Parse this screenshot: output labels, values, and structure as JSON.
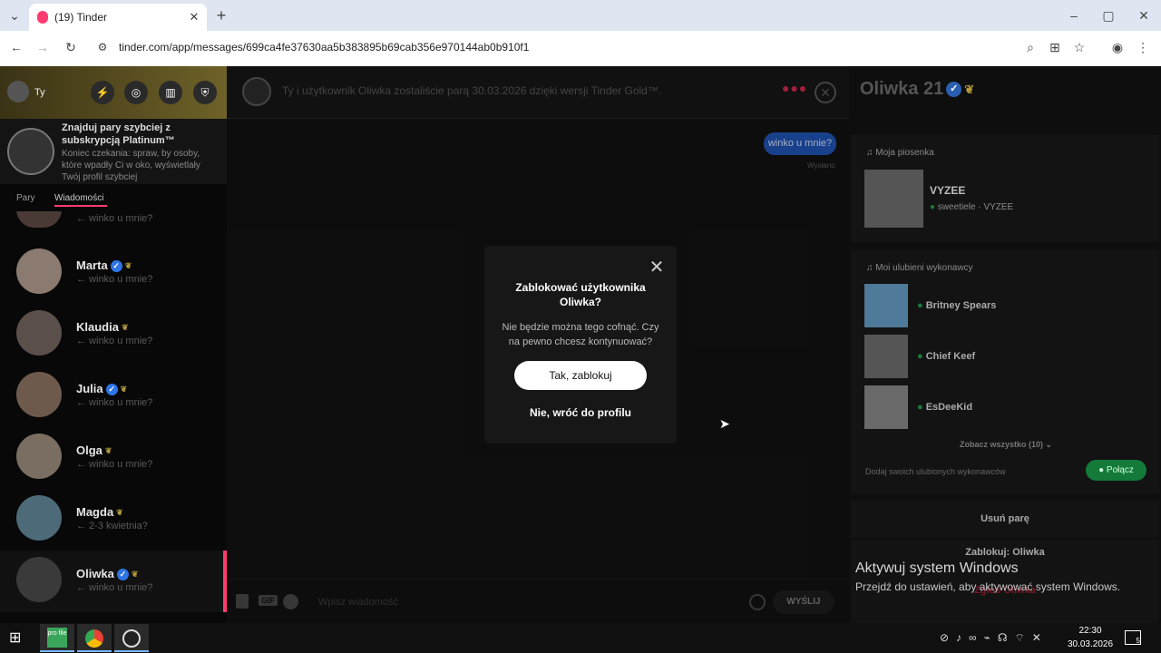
{
  "browser": {
    "tab_title": "(19) Tinder",
    "new_tab": "+",
    "url": "tinder.com/app/messages/699ca4fe37630aa5b383895b69cab356e970144ab0b910f1"
  },
  "left": {
    "user_label": "Ty",
    "promo": {
      "title": "Znajduj pary szybciej z subskrypcją Platinum™",
      "text": "Koniec czekania: spraw, by osoby, które wpadły Ci w oko, wyświetlały Twój profil szybciej"
    },
    "tabs": [
      "Pary",
      "Wiadomości"
    ],
    "partial_preview": "← winko u mnie?",
    "matches": [
      {
        "name": "Marta",
        "verified": true,
        "preview": "← winko u mnie?"
      },
      {
        "name": "Klaudia",
        "verified": false,
        "preview": "← winko u mnie?"
      },
      {
        "name": "Julia",
        "verified": true,
        "preview": "← winko u mnie?"
      },
      {
        "name": "Olga",
        "verified": false,
        "preview": "← winko u mnie?"
      },
      {
        "name": "Magda",
        "verified": false,
        "preview": "← 2-3 kwietnia?"
      },
      {
        "name": "Oliwka",
        "verified": true,
        "preview": "← winko u mnie?"
      }
    ]
  },
  "chat": {
    "header": "Ty i użytkownik Oliwka zostaliście parą 30.03.2026 dzięki wersji Tinder Gold™.",
    "message": "winko u mnie?",
    "status": "Wysłano",
    "input_placeholder": "Wpisz wiadomość",
    "gif_label": "GIF",
    "send_label": "WYŚLIJ"
  },
  "modal": {
    "title": "Zablokować użytkownika Oliwka?",
    "text": "Nie będzie można tego cofnąć. Czy na pewno chcesz kontynuować?",
    "confirm": "Tak, zablokuj",
    "cancel": "Nie, wróć do profilu"
  },
  "profile": {
    "name": "Oliwka 21",
    "song_section": "Moja piosenka",
    "song_title": "VYZEE",
    "song_artist": "sweetiele",
    "song_sep": "·",
    "song_album": "VYZEE",
    "artists_section": "Moi ulubieni wykonawcy",
    "artists": [
      "Britney Spears",
      "Chief Keef",
      "EsDeeKid"
    ],
    "see_all": "Zobacz wszystko (10)",
    "add_artists": "Dodaj swoich ulubionych wykonawców",
    "connect": "Połącz",
    "remove": "Usuń parę",
    "block": "Zablokuj: Oliwka",
    "report": "Zgłoś Oliwka"
  },
  "watermark": {
    "title": "Aktywuj system Windows",
    "text": "Przejdź do ustawień, aby aktywować system Windows."
  },
  "taskbar": {
    "app_label": "pro file",
    "time": "22:30",
    "date": "30.03.2026",
    "notifications": "5"
  },
  "colors": {
    "accent": "#fe3c72",
    "gold": "#c8a840",
    "message_bubble": "#1f5fc8",
    "spotify": "#1db954"
  }
}
